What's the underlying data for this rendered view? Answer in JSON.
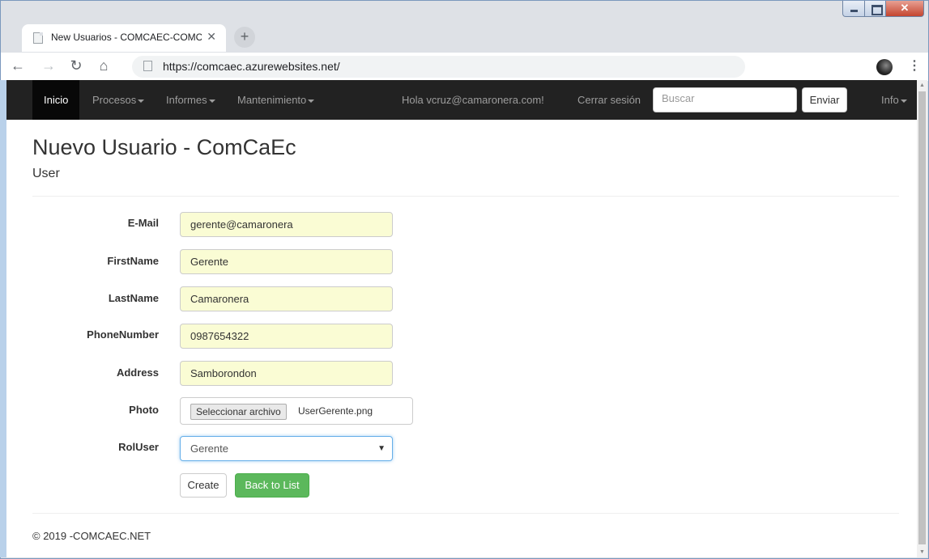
{
  "browser": {
    "tab_title": "New Usuarios - COMCAEC-COMCAEC",
    "tab_close": "✕",
    "new_tab": "+",
    "url": "https://comcaec.azurewebsites.net/"
  },
  "navbar": {
    "home": "Inicio",
    "procesos": "Procesos",
    "informes": "Informes",
    "mantenimiento": "Mantenimiento",
    "greeting": "Hola vcruz@camaronera.com!",
    "logout": "Cerrar sesión",
    "search_placeholder": "Buscar",
    "search_button": "Enviar",
    "info": "Info"
  },
  "page": {
    "title": "Nuevo Usuario - ComCaEc",
    "subtitle": "User"
  },
  "form": {
    "email_label": "E-Mail",
    "email_value": "gerente@camaronera",
    "firstname_label": "FirstName",
    "firstname_value": "Gerente",
    "lastname_label": "LastName",
    "lastname_value": "Camaronera",
    "phone_label": "PhoneNumber",
    "phone_value": "0987654322",
    "address_label": "Address",
    "address_value": "Samborondon",
    "photo_label": "Photo",
    "photo_button": "Seleccionar archivo",
    "photo_file": "UserGerente.png",
    "rol_label": "RolUser",
    "rol_value": "Gerente",
    "create_button": "Create",
    "back_button": "Back to List"
  },
  "footer": {
    "text": "© 2019 -COMCAEC.NET"
  }
}
